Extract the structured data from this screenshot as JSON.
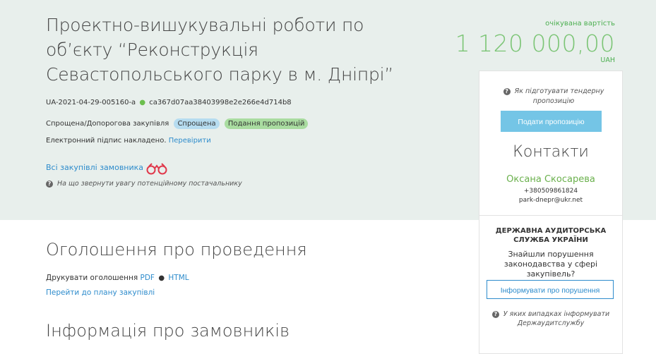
{
  "tender": {
    "title": "Проектно-вишукувальні роботи по об’єкту “Реконструкція Севастопольського парку в м. Дніпрі”",
    "id": "UA-2021-04-29-005160-a",
    "hash": "ca367d07aa38403998e2e266e4d714b8",
    "procurement_type": "Спрощена/Допорогова закупівля",
    "badge_type": "Спрощена",
    "badge_status": "Подання пропозицій",
    "signature_text": "Електронний підпис накладено.",
    "verify_link": "Перевірити",
    "all_purchases_link": "Всі закупівлі замовника",
    "attention_text": "На що звернути увагу потенційному постачальнику"
  },
  "cost": {
    "label": "очікувана вартість",
    "value": "1 120 000,00",
    "currency": "UAH"
  },
  "sidebar": {
    "how_to": "Як підготувати тендерну пропозицію",
    "submit_button": "Подати пропозицію",
    "contacts_heading": "Контакти",
    "contact_name": "Оксана Скосарева",
    "contact_phone": "+380509861824",
    "contact_email": "park-dnepr@ukr.net",
    "audit_heading": "ДЕРЖАВНА АУДИТОРСЬКА СЛУЖБА УКРАЇНИ",
    "audit_question": "Знайшли порушення законодавства у сфері закупівель?",
    "report_button": "Інформувати про порушення",
    "when_report": "У яких випадках інформувати Держаудитслужбу"
  },
  "main": {
    "announcement_heading": "Оголошення про проведення",
    "print_label": "Друкувати оголошення",
    "print_pdf": "PDF",
    "print_html": "HTML",
    "plan_link": "Перейти до плану закупівлі",
    "customers_heading": "Інформація про замовників"
  },
  "colors": {
    "hero_bg": "#e8efec",
    "accent_green": "#7cc576",
    "link_blue": "#2e8ccc",
    "button_blue": "#74c5e6"
  }
}
